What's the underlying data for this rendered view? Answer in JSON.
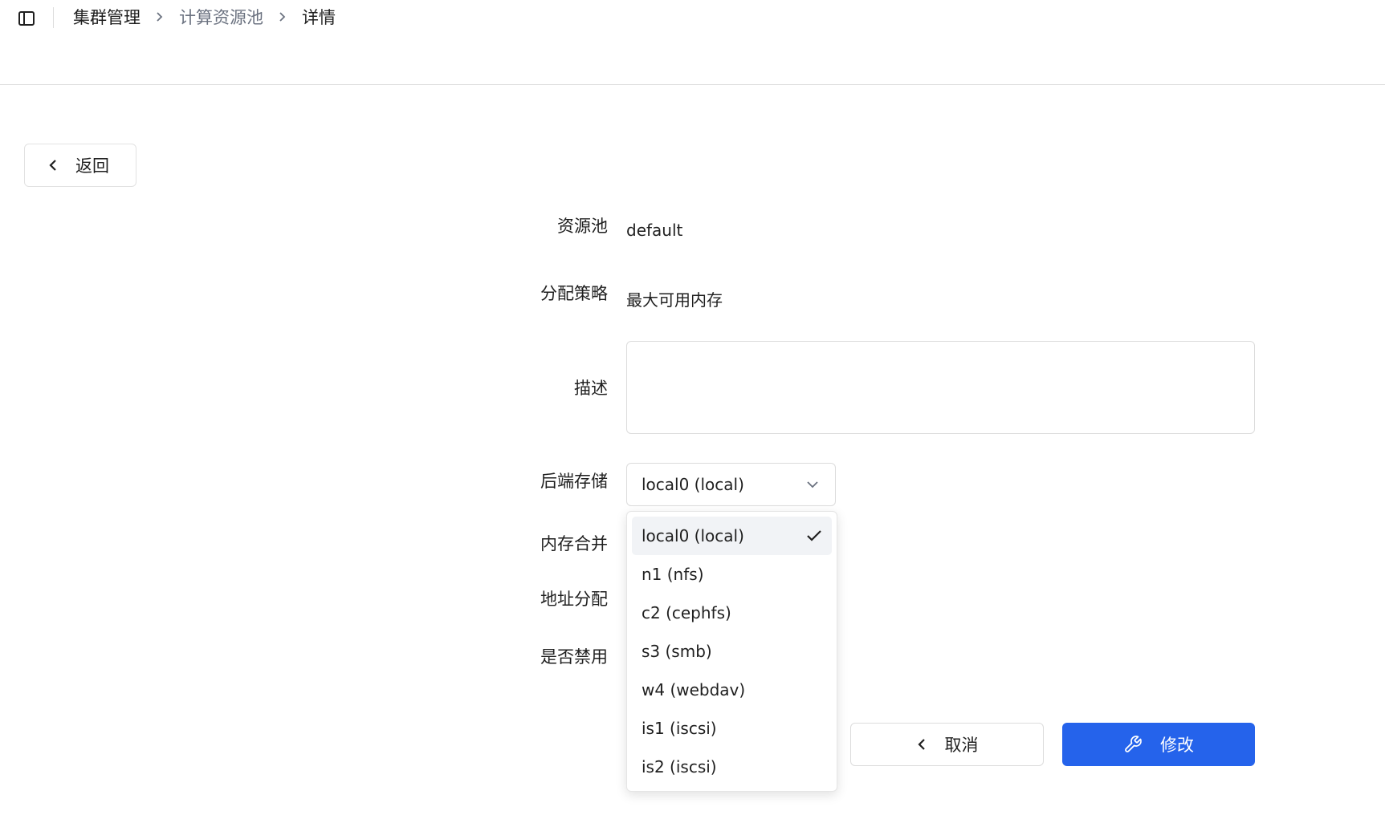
{
  "breadcrumb": {
    "root": "集群管理",
    "parent": "计算资源池",
    "current": "详情"
  },
  "back_button": {
    "label": "返回"
  },
  "form": {
    "pool_label": "资源池",
    "pool_value": "default",
    "strategy_label": "分配策略",
    "strategy_value": "最大可用内存",
    "description_label": "描述",
    "description_value": "",
    "storage_label": "后端存储",
    "storage_selected": "local0 (local)",
    "memory_merge_label": "内存合并",
    "address_alloc_label": "地址分配",
    "disabled_label": "是否禁用"
  },
  "storage_options": [
    "local0 (local)",
    "n1 (nfs)",
    "c2 (cephfs)",
    "s3 (smb)",
    "w4 (webdav)",
    "is1 (iscsi)",
    "is2 (iscsi)"
  ],
  "actions": {
    "cancel_label": "取消",
    "modify_label": "修改"
  },
  "icons": {
    "sidebar_toggle": "panel-left-icon",
    "breadcrumb_separator": "chevron-right-icon",
    "back": "chevron-left-icon",
    "select_caret": "chevron-down-icon",
    "selected_check": "check-icon",
    "modify": "wrench-icon"
  },
  "colors": {
    "primary": "#2563eb",
    "muted_text": "#6b7280",
    "border": "#dcdcdc",
    "selected_option_bg": "#f1f3f6"
  }
}
